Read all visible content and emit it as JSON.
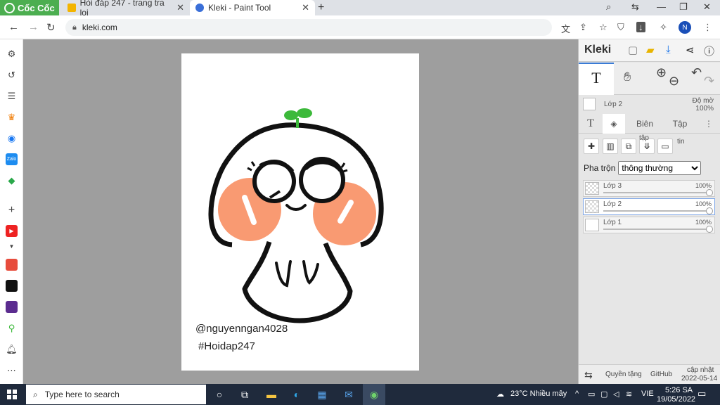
{
  "browser": {
    "brand": "Cốc Cốc",
    "tabs": [
      {
        "title": "Hỏi đáp 247 - trang tra loi",
        "active": false
      },
      {
        "title": "Kleki - Paint Tool",
        "active": true
      }
    ],
    "url": "kleki.com",
    "profile_initial": "N"
  },
  "canvas": {
    "caption_user": "@nguyenngan4028",
    "caption_tag": "#Hoidap247"
  },
  "kleki": {
    "title": "Kleki",
    "current_layer": "Lớp 2",
    "opacity_label": "Độ mờ",
    "opacity_value": "100%",
    "tabs": {
      "edit": "Biên",
      "file": "Tập"
    },
    "btn_labels": {
      "tap": "tập",
      "tin": "tin"
    },
    "blend_label": "Pha trộn",
    "blend_value": "thông thường",
    "layers": [
      {
        "name": "Lớp 3",
        "opacity": "100%",
        "selected": false
      },
      {
        "name": "Lớp 2",
        "opacity": "100%",
        "selected": true
      },
      {
        "name": "Lớp 1",
        "opacity": "100%",
        "selected": false
      }
    ],
    "footer": {
      "privacy": "Quyền tặng",
      "github": "GitHub",
      "update": "cập nhật",
      "date": "2022-05-14"
    }
  },
  "taskbar": {
    "search_placeholder": "Type here to search",
    "weather": "23°C  Nhiều mây",
    "lang": "VIE",
    "time": "5:26 SA",
    "date": "19/05/2022"
  },
  "colors": {
    "accent": "#4cae50",
    "blush": "#f99a72",
    "leaf": "#3cb93a"
  }
}
